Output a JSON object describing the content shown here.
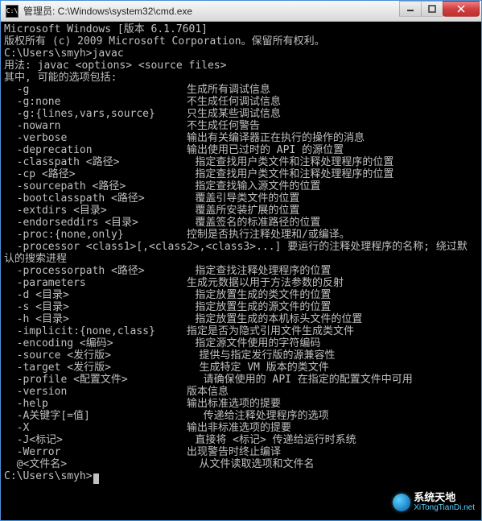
{
  "window": {
    "title": "管理员: C:\\Windows\\system32\\cmd.exe",
    "icon_label": "C:\\"
  },
  "terminal": {
    "lines": [
      "Microsoft Windows [版本 6.1.7601]",
      "版权所有 (c) 2009 Microsoft Corporation。保留所有权利。",
      "",
      "C:\\Users\\smyh>javac",
      "用法: javac <options> <source files>",
      "其中, 可能的选项包括:",
      "  -g                         生成所有调试信息",
      "  -g:none                    不生成任何调试信息",
      "  -g:{lines,vars,source}     只生成某些调试信息",
      "  -nowarn                    不生成任何警告",
      "  -verbose                   输出有关编译器正在执行的操作的消息",
      "  -deprecation               输出使用已过时的 API 的源位置",
      "  -classpath <路径>            指定查找用户类文件和注释处理程序的位置",
      "  -cp <路径>                   指定查找用户类文件和注释处理程序的位置",
      "  -sourcepath <路径>           指定查找输入源文件的位置",
      "  -bootclasspath <路径>        覆盖引导类文件的位置",
      "  -extdirs <目录>              覆盖所安装扩展的位置",
      "  -endorseddirs <目录>         覆盖签名的标准路径的位置",
      "  -proc:{none,only}          控制是否执行注释处理和/或编译。",
      "  -processor <class1>[,<class2>,<class3>...] 要运行的注释处理程序的名称; 绕过默",
      "认的搜索进程",
      "  -processorpath <路径>        指定查找注释处理程序的位置",
      "  -parameters                生成元数据以用于方法参数的反射",
      "  -d <目录>                    指定放置生成的类文件的位置",
      "  -s <目录>                    指定放置生成的源文件的位置",
      "  -h <目录>                    指定放置生成的本机标头文件的位置",
      "  -implicit:{none,class}     指定是否为隐式引用文件生成类文件",
      "  -encoding <编码>             指定源文件使用的字符编码",
      "  -source <发行版>              提供与指定发行版的源兼容性",
      "  -target <发行版>              生成特定 VM 版本的类文件",
      "  -profile <配置文件>            请确保使用的 API 在指定的配置文件中可用",
      "  -version                   版本信息",
      "  -help                      输出标准选项的提要",
      "  -A关键字[=值]                  传递给注释处理程序的选项",
      "  -X                         输出非标准选项的提要",
      "  -J<标记>                     直接将 <标记> 传递给运行时系统",
      "  -Werror                    出现警告时终止编译",
      "  @<文件名>                     从文件读取选项和文件名",
      "",
      "",
      "C:\\Users\\smyh>"
    ],
    "prompt_has_cursor": true
  },
  "watermark": {
    "brand": "系统天地",
    "url": "XiTongTianDi.net"
  }
}
